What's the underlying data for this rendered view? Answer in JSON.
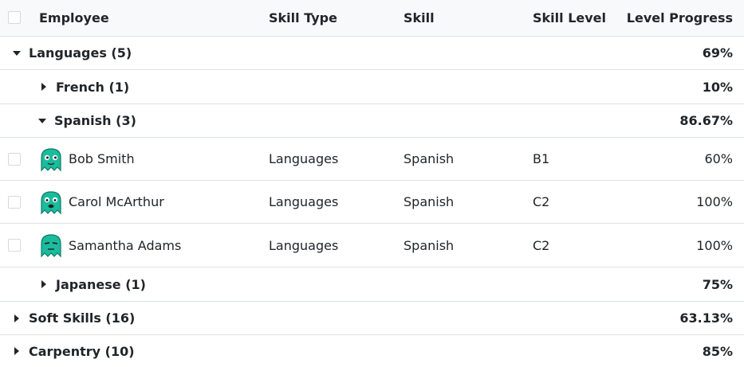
{
  "header": {
    "employee": "Employee",
    "skill_type": "Skill Type",
    "skill": "Skill",
    "skill_level": "Skill Level",
    "level_progress": "Level Progress"
  },
  "groups": [
    {
      "label": "Languages (5)",
      "progress": "69%"
    },
    {
      "label": "French (1)",
      "progress": "10%"
    },
    {
      "label": "Spanish (3)",
      "progress": "86.67%"
    },
    {
      "label": "Japanese (1)",
      "progress": "75%"
    },
    {
      "label": "Soft Skills (16)",
      "progress": "63.13%"
    },
    {
      "label": "Carpentry (10)",
      "progress": "85%"
    }
  ],
  "records": [
    {
      "employee": "Bob Smith",
      "skill_type": "Languages",
      "skill": "Spanish",
      "level": "B1",
      "progress": "60%"
    },
    {
      "employee": "Carol McArthur",
      "skill_type": "Languages",
      "skill": "Spanish",
      "level": "C2",
      "progress": "100%"
    },
    {
      "employee": "Samantha Adams",
      "skill_type": "Languages",
      "skill": "Spanish",
      "level": "C2",
      "progress": "100%"
    }
  ],
  "colors": {
    "avatar": "#1abc9c",
    "header_bg": "#f8f9fa",
    "border": "#dee2e6"
  },
  "icons": {
    "expanded": "caret-down-icon",
    "collapsed": "caret-right-icon",
    "avatar": "ghost-avatar-icon"
  }
}
